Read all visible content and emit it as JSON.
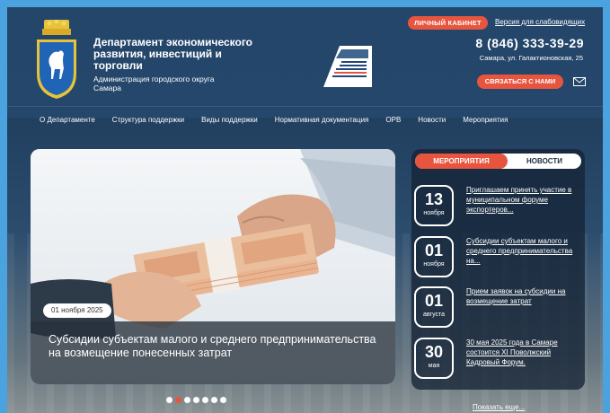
{
  "header": {
    "org_title": "Департамент экономического развития, инвестиций и торговли",
    "org_subtitle": "Администрация городского округа Самара",
    "cabinet_label": "ЛИЧНЫЙ КАБИНЕТ",
    "accessible_label": "Версия для слабовидящих",
    "phone": "8 (846) 333-39-29",
    "address": "Самара, ул. Галактионовская, 25",
    "contact_label": "СВЯЗАТЬСЯ С НАМИ",
    "natproj_text": "НАЦИОНАЛЬНЫЕ ПРОЕКТЫ РОССИИ"
  },
  "nav": {
    "items": [
      {
        "label": "О Департаменте"
      },
      {
        "label": "Структура поддержки"
      },
      {
        "label": "Виды поддержки"
      },
      {
        "label": "Нормативная документация"
      },
      {
        "label": "ОРВ"
      },
      {
        "label": "Новости"
      },
      {
        "label": "Мероприятия"
      }
    ]
  },
  "hero": {
    "date": "01 ноября 2025",
    "caption": "Субсидии субъектам малого и среднего предпринимательства на возмещение понесенных затрат",
    "slides_total": 7,
    "slide_active": 2
  },
  "panel": {
    "tab_events": "МЕРОПРИЯТИЯ",
    "tab_news": "НОВОСТИ",
    "events": [
      {
        "day": "13",
        "month": "ноября",
        "title": "Приглашаем принять участие в муниципальном форуме экспортеров..."
      },
      {
        "day": "01",
        "month": "ноября",
        "title": "Субсидии субъектам малого и среднего предпринимательства на..."
      },
      {
        "day": "01",
        "month": "августа",
        "title": "Прием заявок на субсидии на возмещение затрат"
      },
      {
        "day": "30",
        "month": "мая",
        "title": "30 мая 2025 года в Самаре состоится XI Поволжский Кадровый Форум."
      }
    ],
    "show_more": "Показать еще..."
  },
  "colors": {
    "accent": "#e8553f",
    "header_bg": "#24466a",
    "page_border": "#4aa3df"
  },
  "icons": {
    "emblem": "samara-coat-of-arms-icon",
    "mail": "mail-icon",
    "natproj": "national-projects-logo"
  }
}
